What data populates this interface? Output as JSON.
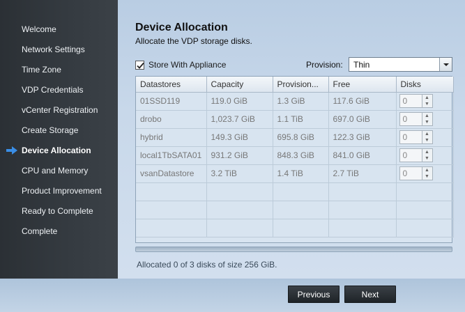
{
  "sidebar": {
    "items": [
      {
        "label": "Welcome"
      },
      {
        "label": "Network Settings"
      },
      {
        "label": "Time Zone"
      },
      {
        "label": "VDP Credentials"
      },
      {
        "label": "vCenter Registration"
      },
      {
        "label": "Create Storage"
      },
      {
        "label": "Device Allocation"
      },
      {
        "label": "CPU and Memory"
      },
      {
        "label": "Product Improvement"
      },
      {
        "label": "Ready to Complete"
      },
      {
        "label": "Complete"
      }
    ],
    "active_index": 6
  },
  "main": {
    "title": "Device Allocation",
    "subtitle": "Allocate the VDP storage disks.",
    "store_with_appliance": {
      "label": "Store With Appliance",
      "checked": true
    },
    "provision": {
      "label": "Provision:",
      "value": "Thin"
    },
    "table": {
      "headers": [
        "Datastores",
        "Capacity",
        "Provision...",
        "Free",
        "Disks"
      ],
      "rows": [
        {
          "datastore": "01SSD119",
          "capacity": "119.0 GiB",
          "provisioned": "1.3 GiB",
          "free": "117.6 GiB",
          "disks": "0"
        },
        {
          "datastore": "drobo",
          "capacity": "1,023.7 GiB",
          "provisioned": "1.1 TiB",
          "free": "697.0 GiB",
          "disks": "0"
        },
        {
          "datastore": "hybrid",
          "capacity": "149.3 GiB",
          "provisioned": "695.8 GiB",
          "free": "122.3 GiB",
          "disks": "0"
        },
        {
          "datastore": "local1TbSATA01",
          "capacity": "931.2 GiB",
          "provisioned": "848.3 GiB",
          "free": "841.0 GiB",
          "disks": "0"
        },
        {
          "datastore": "vsanDatastore",
          "capacity": "3.2 TiB",
          "provisioned": "1.4 TiB",
          "free": "2.7 TiB",
          "disks": "0"
        }
      ]
    },
    "allocated_text": "Allocated 0 of 3 disks of size 256 GiB."
  },
  "footer": {
    "previous_label": "Previous",
    "next_label": "Next"
  },
  "colors": {
    "sidebar_bg": "#30363c",
    "accent_arrow": "#3a8ee6",
    "main_bg": "#c8d8ea"
  },
  "icons": {
    "active_marker": "right-arrow-icon",
    "checkbox": "checkmark-icon",
    "select": "chevron-down-icon",
    "spinner_up": "spinner-up-icon",
    "spinner_down": "spinner-down-icon"
  }
}
